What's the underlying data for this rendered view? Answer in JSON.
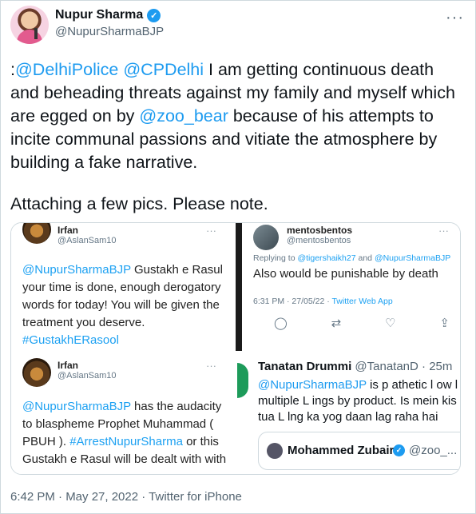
{
  "author": {
    "name": "Nupur Sharma",
    "handle": "@NupurSharmaBJP",
    "verified_icon": "✓",
    "more_icon": "···"
  },
  "tweet": {
    "prefix": ":",
    "mention_1": "@DelhiPolice",
    "mention_2": "@CPDelhi",
    "text_1": " I am getting continuous death and beheading threats against my family and myself which are egged on by ",
    "mention_3": "@zoo_bear",
    "text_2": " because of his attempts to incite communal passions and vitiate the atmosphere by building a fake narrative.",
    "text_3": "Attaching a few pics. Please note."
  },
  "media": {
    "top_left": {
      "name": "Irfan",
      "handle": "@AslanSam10",
      "dots": "···",
      "mention": "@NupurSharmaBJP",
      "text": " Gustakh e Rasul your time is done, enough derogatory words for today! You will be given the treatment you deserve.",
      "hashtag": "#GustakhERasool"
    },
    "top_right": {
      "name": "mentosbentos",
      "handle": "@mentosbentos",
      "dots": "···",
      "replying_prefix": "Replying to ",
      "replying_1": "@tigershaikh27",
      "replying_and": " and ",
      "replying_2": "@NupurSharmaBJP",
      "text": "Also would be punishable by death",
      "time": "6:31 PM · 27/05/22 · ",
      "source": "Twitter Web App",
      "action_reply": "◯",
      "action_retweet": "⇄",
      "action_like": "♡",
      "action_share": "⇪"
    },
    "bottom_left": {
      "name": "Irfan",
      "handle": "@AslanSam10",
      "dots": "···",
      "mention": "@NupurSharmaBJP",
      "text_1": " has the audacity to blaspheme Prophet Muhammad ( PBUH ). ",
      "hashtag": "#ArrestNupurSharma",
      "text_2": " or this Gustakh e Rasul will be dealt with with"
    },
    "bottom_right": {
      "name": "Tanatan Drummi",
      "handle": "@TanatanD · 25m",
      "mention": "@NupurSharmaBJP",
      "text": " is p athetic l ow l multiple L ings by product. Is mein kis tua L lng ka yog daan lag raha hai",
      "quote_name": "Mohammed Zubair",
      "quote_handle": "@zoo_...",
      "quote_verified_icon": "✓"
    }
  },
  "footer": {
    "time": "6:42 PM · May 27, 2022 · ",
    "source": "Twitter for iPhone"
  }
}
